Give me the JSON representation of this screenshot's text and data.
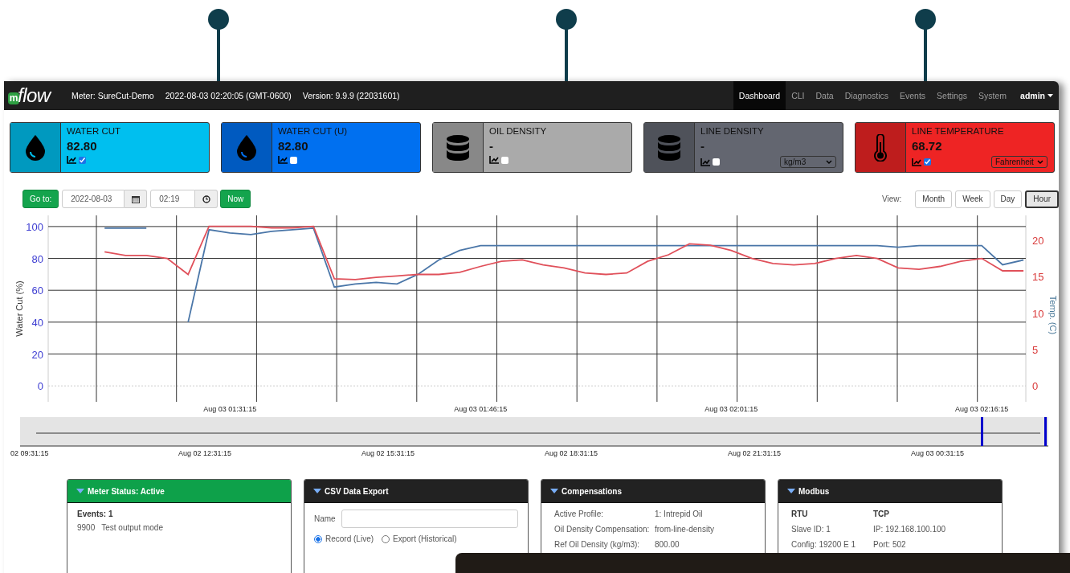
{
  "navbar": {
    "logo": {
      "badge": "m",
      "text": "flow"
    },
    "meter": "Meter: SureCut-Demo",
    "datetime": "2022-08-03 02:20:05 (GMT-0600)",
    "version": "Version: 9.9.9 (22031601)",
    "menu": [
      {
        "label": "Dashboard",
        "selected": true
      },
      {
        "label": "CLI",
        "selected": false
      },
      {
        "label": "Data",
        "selected": false
      },
      {
        "label": "Diagnostics",
        "selected": false
      },
      {
        "label": "Events",
        "selected": false
      },
      {
        "label": "Settings",
        "selected": false
      },
      {
        "label": "System",
        "selected": false
      }
    ],
    "user": "admin"
  },
  "cards": [
    {
      "kind": "drop",
      "title": "WATER CUT",
      "value": "82.80",
      "color": "#00bfef",
      "chart_visible": true
    },
    {
      "kind": "drop",
      "title": "WATER CUT (U)",
      "value": "82.80",
      "color": "#0070f0",
      "chart_visible": false
    },
    {
      "kind": "database",
      "title": "OIL DENSITY",
      "value": "-",
      "color": "#aaaaaa",
      "chart_visible": false
    },
    {
      "kind": "database",
      "title": "LINE DENSITY",
      "value": "-",
      "color": "#636670",
      "chart_visible": false,
      "unit": "kg/m3"
    },
    {
      "kind": "thermometer",
      "title": "LINE TEMPERATURE",
      "value": "68.72",
      "color": "#ee2424",
      "chart_visible": true,
      "unit": "Fahrenheit"
    }
  ],
  "toolbar": {
    "goto_button": "Go to:",
    "date": "2022-08-03",
    "time": "02:19",
    "now_button": "Now",
    "view_label": "View:",
    "views": [
      {
        "label": "Month",
        "selected": false
      },
      {
        "label": "Week",
        "selected": false
      },
      {
        "label": "Day",
        "selected": false
      },
      {
        "label": "Hour",
        "selected": true
      }
    ]
  },
  "chart": {
    "chart_data": {
      "type": "line",
      "grid": true,
      "ref_lines": [
        {
          "axis": "y",
          "value": 0,
          "color": "#cccccc"
        }
      ],
      "ylabel": "Water Cut (%)",
      "y2label": "Temp. (C)",
      "ylim": [
        -10,
        107
      ],
      "y2lim": [
        -2.19,
        23.41
      ],
      "yticks": [
        0,
        20,
        40,
        60,
        80,
        100
      ],
      "y2ticks": [
        0,
        5,
        10,
        15,
        20
      ],
      "categories": [
        null,
        null,
        null,
        null,
        null,
        null,
        null,
        null,
        "Aug 03 01:31:15",
        null,
        null,
        null,
        null,
        null,
        null,
        null,
        null,
        null,
        null,
        null,
        "Aug 03 01:46:15",
        null,
        null,
        null,
        null,
        null,
        null,
        null,
        null,
        null,
        null,
        null,
        "Aug 03 02:01:15",
        null,
        null,
        null,
        null,
        null,
        null,
        null,
        null,
        null,
        null,
        null,
        "Aug 03 02:16:15",
        null,
        null
      ],
      "series": [
        {
          "color": "#4a76a8",
          "values": [
            null,
            null,
            99,
            99,
            99,
            null,
            40,
            98,
            96,
            95,
            97,
            98,
            99,
            62,
            64,
            65,
            64,
            70,
            79,
            85,
            88,
            88,
            88,
            88,
            88,
            88,
            88,
            88,
            88,
            88,
            88,
            88,
            88,
            88,
            88,
            88,
            88,
            88,
            88,
            88,
            87,
            88,
            88,
            88,
            88,
            76,
            79
          ]
        },
        {
          "axis": "y2",
          "color": "#e0505a",
          "values": [
            null,
            null,
            18.4,
            17.9,
            17.9,
            17.5,
            15.3,
            21.9,
            21.9,
            21.9,
            21.7,
            21.7,
            21.9,
            14.7,
            14.6,
            14.9,
            15.1,
            15.3,
            15.3,
            15.6,
            16.4,
            17.1,
            17.3,
            16.6,
            16.2,
            15.5,
            15.3,
            15.5,
            17.1,
            18.0,
            19.5,
            19.3,
            18.6,
            17.5,
            16.8,
            16.6,
            16.8,
            17.5,
            17.9,
            17.5,
            16.2,
            16.0,
            16.4,
            17.1,
            17.5,
            15.8,
            15.8
          ]
        }
      ]
    }
  },
  "navigator": {
    "tick_labels": [
      "02 09:31:15",
      "Aug 02 12:31:15",
      "Aug 02 15:31:15",
      "Aug 02 18:31:15",
      "Aug 02 21:31:15",
      "Aug 03 00:31:15"
    ]
  },
  "panels": [
    {
      "kind": "status",
      "title": "Meter Status: Active",
      "active": true,
      "events_label": "Events: 1",
      "events": [
        {
          "code": "9900",
          "text": "Test output mode"
        }
      ]
    },
    {
      "kind": "csv",
      "title": "CSV Data Export",
      "active": false,
      "name_label": "Name",
      "options": [
        {
          "label": "Record (Live)",
          "selected": true
        },
        {
          "label": "Export (Historical)",
          "selected": false
        }
      ]
    },
    {
      "kind": "compensations",
      "title": "Compensations",
      "active": false,
      "rows": [
        {
          "label": "Active Profile:",
          "value": "1: Intrepid Oil"
        },
        {
          "label": "Oil Density Compensation:",
          "value": "from-line-density"
        },
        {
          "label": "Ref Oil Density (kg/m3):",
          "value": "800.00"
        }
      ]
    },
    {
      "kind": "modbus",
      "title": "Modbus",
      "active": false,
      "columns": [
        "RTU",
        "TCP"
      ],
      "rows": [
        [
          "Slave ID: 1",
          "IP: 192.168.100.100"
        ],
        [
          "Config: 19200 E 1",
          "Port: 502"
        ]
      ]
    }
  ]
}
